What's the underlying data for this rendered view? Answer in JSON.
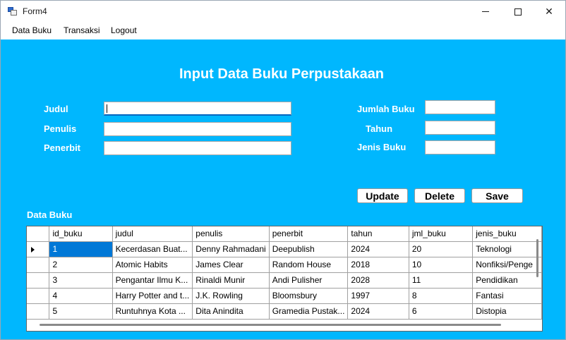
{
  "window": {
    "title": "Form4",
    "icon": "form-app-icon",
    "controls": {
      "minimize_icon": "minimize-icon",
      "maximize_icon": "maximize-icon",
      "close_icon": "close-icon",
      "close_glyph": "✕"
    }
  },
  "menu": {
    "items": [
      "Data Buku",
      "Transaksi",
      "Logout"
    ]
  },
  "form": {
    "heading": "Input Data Buku Perpustakaan",
    "labels": {
      "judul": "Judul",
      "penulis": "Penulis",
      "penerbit": "Penerbit",
      "jumlah_buku": "Jumlah Buku",
      "tahun": "Tahun",
      "jenis_buku": "Jenis Buku"
    },
    "values": {
      "judul": "",
      "penulis": "",
      "penerbit": "",
      "jumlah_buku": "",
      "tahun": "",
      "jenis_buku": ""
    },
    "buttons": {
      "update": "Update",
      "delete": "Delete",
      "save": "Save"
    },
    "accent_color": "#00b7fe"
  },
  "grid": {
    "section_label": "Data Buku",
    "columns": [
      "id_buku",
      "judul",
      "penulis",
      "penerbit",
      "tahun",
      "jml_buku",
      "jenis_buku"
    ],
    "rows": [
      [
        "1",
        "Kecerdasan Buat...",
        "Denny Rahmadani",
        "Deepublish",
        "2024",
        "20",
        "Teknologi"
      ],
      [
        "2",
        "Atomic Habits",
        "James Clear",
        "Random House",
        "2018",
        "10",
        "Nonfiksi/Penge"
      ],
      [
        "3",
        "Pengantar Ilmu K...",
        "Rinaldi Munir",
        "Andi Pulisher",
        "2028",
        "11",
        "Pendidikan"
      ],
      [
        "4",
        "Harry Potter and t...",
        "J.K. Rowling",
        "Bloomsbury",
        "1997",
        "8",
        "Fantasi"
      ],
      [
        "5",
        "Runtuhnya Kota ...",
        "Dita Anindita",
        "Gramedia Pustak...",
        "2024",
        "6",
        "Distopia"
      ]
    ],
    "selected_row": 0,
    "selected_color": "#0078d7"
  }
}
